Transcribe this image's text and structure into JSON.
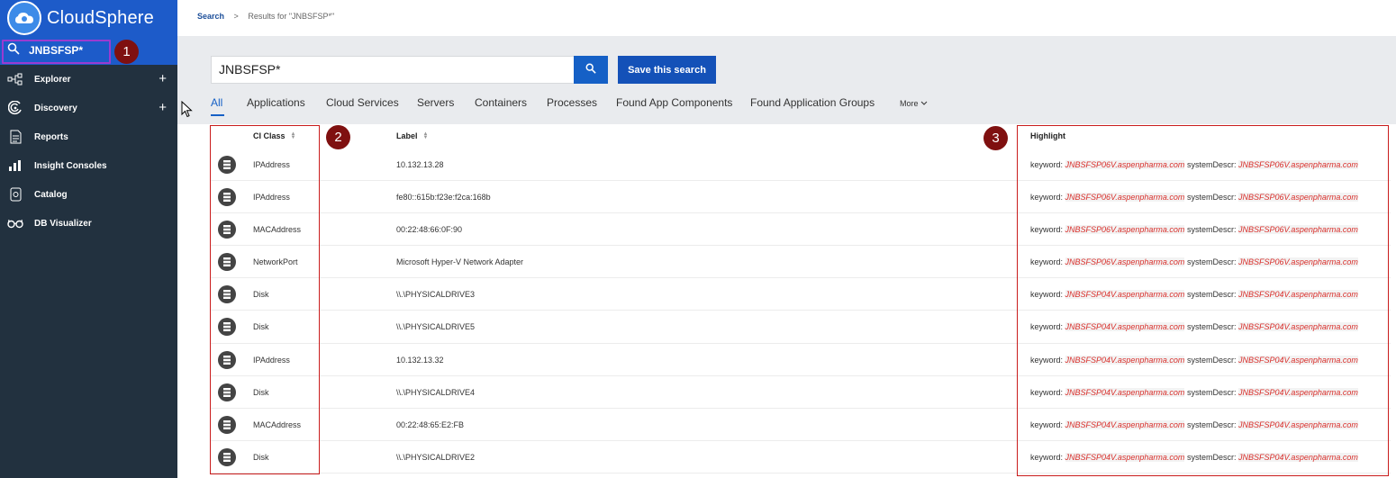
{
  "brand": {
    "name": "CloudSphere"
  },
  "sidebar": {
    "search_query": "JNBSFSP*",
    "items": [
      {
        "label": "Explorer",
        "icon": "explorer-icon",
        "expandable": true
      },
      {
        "label": "Discovery",
        "icon": "discovery-icon",
        "expandable": true
      },
      {
        "label": "Reports",
        "icon": "reports-icon",
        "expandable": false
      },
      {
        "label": "Insight Consoles",
        "icon": "chart-icon",
        "expandable": false
      },
      {
        "label": "Catalog",
        "icon": "catalog-icon",
        "expandable": false
      },
      {
        "label": "DB Visualizer",
        "icon": "glasses-icon",
        "expandable": false
      }
    ]
  },
  "breadcrumb": {
    "root": "Search",
    "separator": ">",
    "current": "Results for \"JNBSFSP*\""
  },
  "search": {
    "value": "JNBSFSP*",
    "save_label": "Save this search"
  },
  "tabs": [
    "All",
    "Applications",
    "Cloud Services",
    "Servers",
    "Containers",
    "Processes",
    "Found App Components",
    "Found Application Groups"
  ],
  "more_label": "More",
  "table": {
    "headers": {
      "ci_class": "CI Class",
      "label": "Label",
      "highlight": "Highlight"
    },
    "highlight_prefix_1": "keyword:",
    "highlight_prefix_2": "systemDescr:",
    "rows": [
      {
        "ci_class": "IPAddress",
        "label": "10.132.13.28",
        "host": "JNBSFSP06V.aspenpharma.com"
      },
      {
        "ci_class": "IPAddress",
        "label": "fe80::615b:f23e:f2ca:168b",
        "host": "JNBSFSP06V.aspenpharma.com"
      },
      {
        "ci_class": "MACAddress",
        "label": "00:22:48:66:0F:90",
        "host": "JNBSFSP06V.aspenpharma.com"
      },
      {
        "ci_class": "NetworkPort",
        "label": "Microsoft Hyper-V Network Adapter",
        "host": "JNBSFSP06V.aspenpharma.com"
      },
      {
        "ci_class": "Disk",
        "label": "\\\\.\\PHYSICALDRIVE3",
        "host": "JNBSFSP04V.aspenpharma.com"
      },
      {
        "ci_class": "Disk",
        "label": "\\\\.\\PHYSICALDRIVE5",
        "host": "JNBSFSP04V.aspenpharma.com"
      },
      {
        "ci_class": "IPAddress",
        "label": "10.132.13.32",
        "host": "JNBSFSP04V.aspenpharma.com"
      },
      {
        "ci_class": "Disk",
        "label": "\\\\.\\PHYSICALDRIVE4",
        "host": "JNBSFSP04V.aspenpharma.com"
      },
      {
        "ci_class": "MACAddress",
        "label": "00:22:48:65:E2:FB",
        "host": "JNBSFSP04V.aspenpharma.com"
      },
      {
        "ci_class": "Disk",
        "label": "\\\\.\\PHYSICALDRIVE2",
        "host": "JNBSFSP04V.aspenpharma.com"
      }
    ]
  },
  "callouts": [
    "1",
    "2",
    "3"
  ],
  "colors": {
    "sidebar_bg": "#22313f",
    "brand_blue": "#1d5bc9",
    "accent": "#1560c6",
    "highlight_red": "#d9302c",
    "callout": "#7f1010"
  }
}
